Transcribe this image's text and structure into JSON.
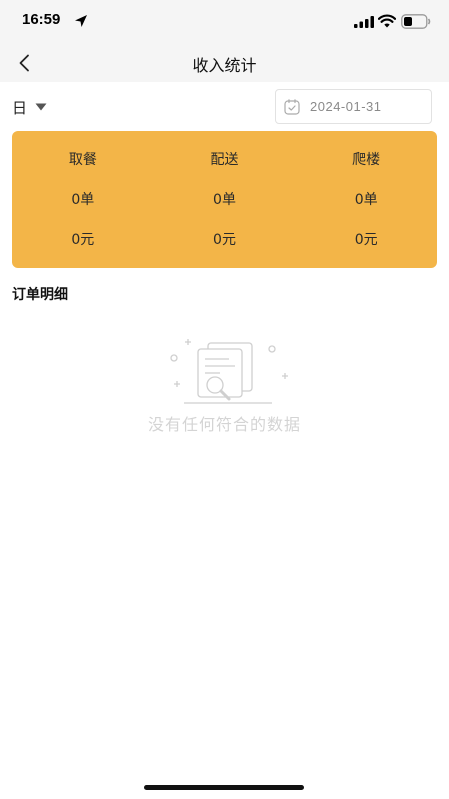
{
  "status_bar": {
    "time": "16:59"
  },
  "nav": {
    "title": "收入统计"
  },
  "filter": {
    "period": "日",
    "date": "2024-01-31"
  },
  "stats": {
    "columns": [
      {
        "label": "取餐",
        "orders": "0单",
        "income": "0元"
      },
      {
        "label": "配送",
        "orders": "0单",
        "income": "0元"
      },
      {
        "label": "爬楼",
        "orders": "0单",
        "income": "0元"
      }
    ]
  },
  "orders": {
    "section_title": "订单明细",
    "empty_text": "没有任何符合的数据"
  },
  "colors": {
    "card": "#f3b548",
    "nav_bg": "#f5f5f5",
    "muted": "#d4d4d4"
  }
}
